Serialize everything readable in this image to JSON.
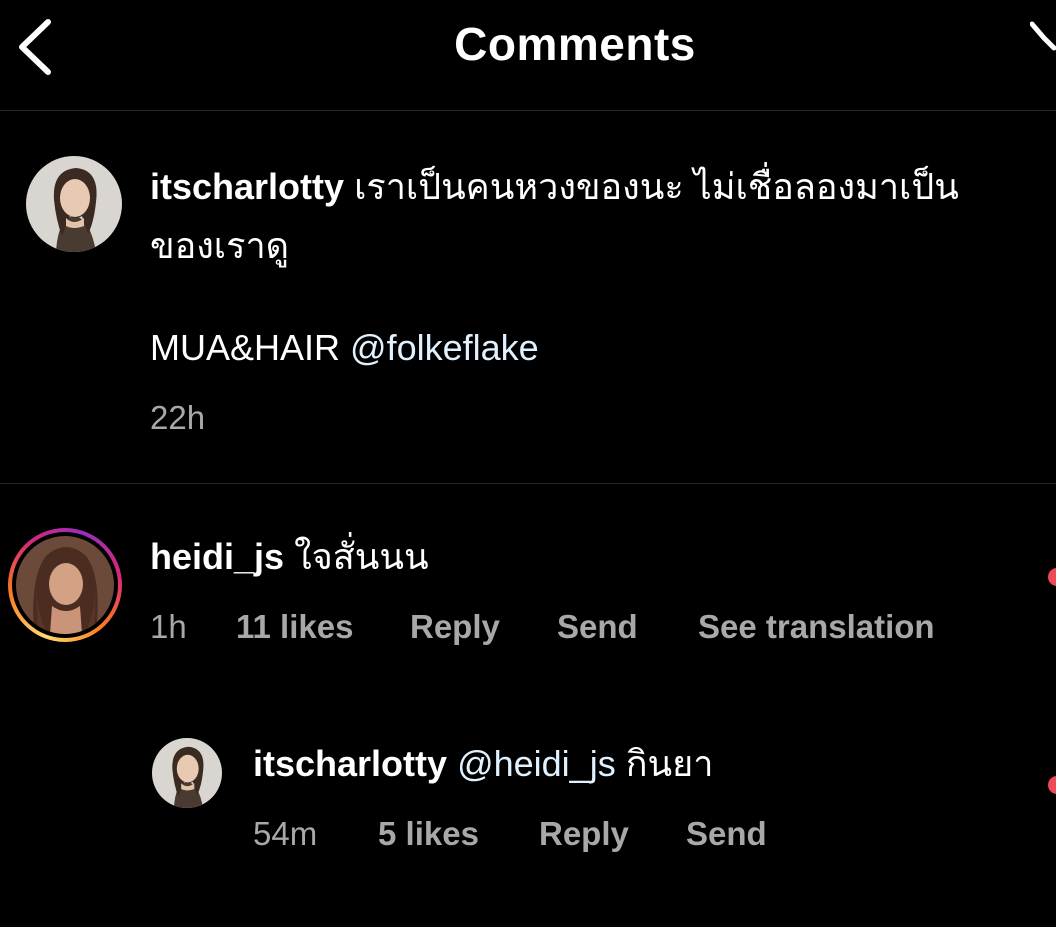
{
  "header": {
    "title": "Comments"
  },
  "colors": {
    "background": "#000000",
    "text": "#ffffff",
    "secondary_text": "#a8a8a8",
    "mention": "#e0f1ff",
    "divider": "#262626",
    "like_red": "#ed4956"
  },
  "caption": {
    "username": "itscharlotty",
    "line1": "เราเป็นคนหวงของนะ ไม่เชื่อลองมาเป็น",
    "line2": "ของเราดู",
    "credit_prefix": "MUA&HAIR",
    "credit_mention": "@folkeflake",
    "time": "22h"
  },
  "comments": [
    {
      "username": "heidi_js",
      "text": "ใจสั่นนน",
      "time": "1h",
      "likes": "11 likes",
      "reply_label": "Reply",
      "send_label": "Send",
      "translate_label": "See translation",
      "has_story_ring": true,
      "replies": [
        {
          "username": "itscharlotty",
          "mention": "@heidi_js",
          "text": "กินยา",
          "time": "54m",
          "likes": "5 likes",
          "reply_label": "Reply",
          "send_label": "Send"
        }
      ]
    }
  ],
  "icons": {
    "back": "chevron-left-icon",
    "dm": "paper-plane-icon",
    "like": "heart-icon"
  }
}
